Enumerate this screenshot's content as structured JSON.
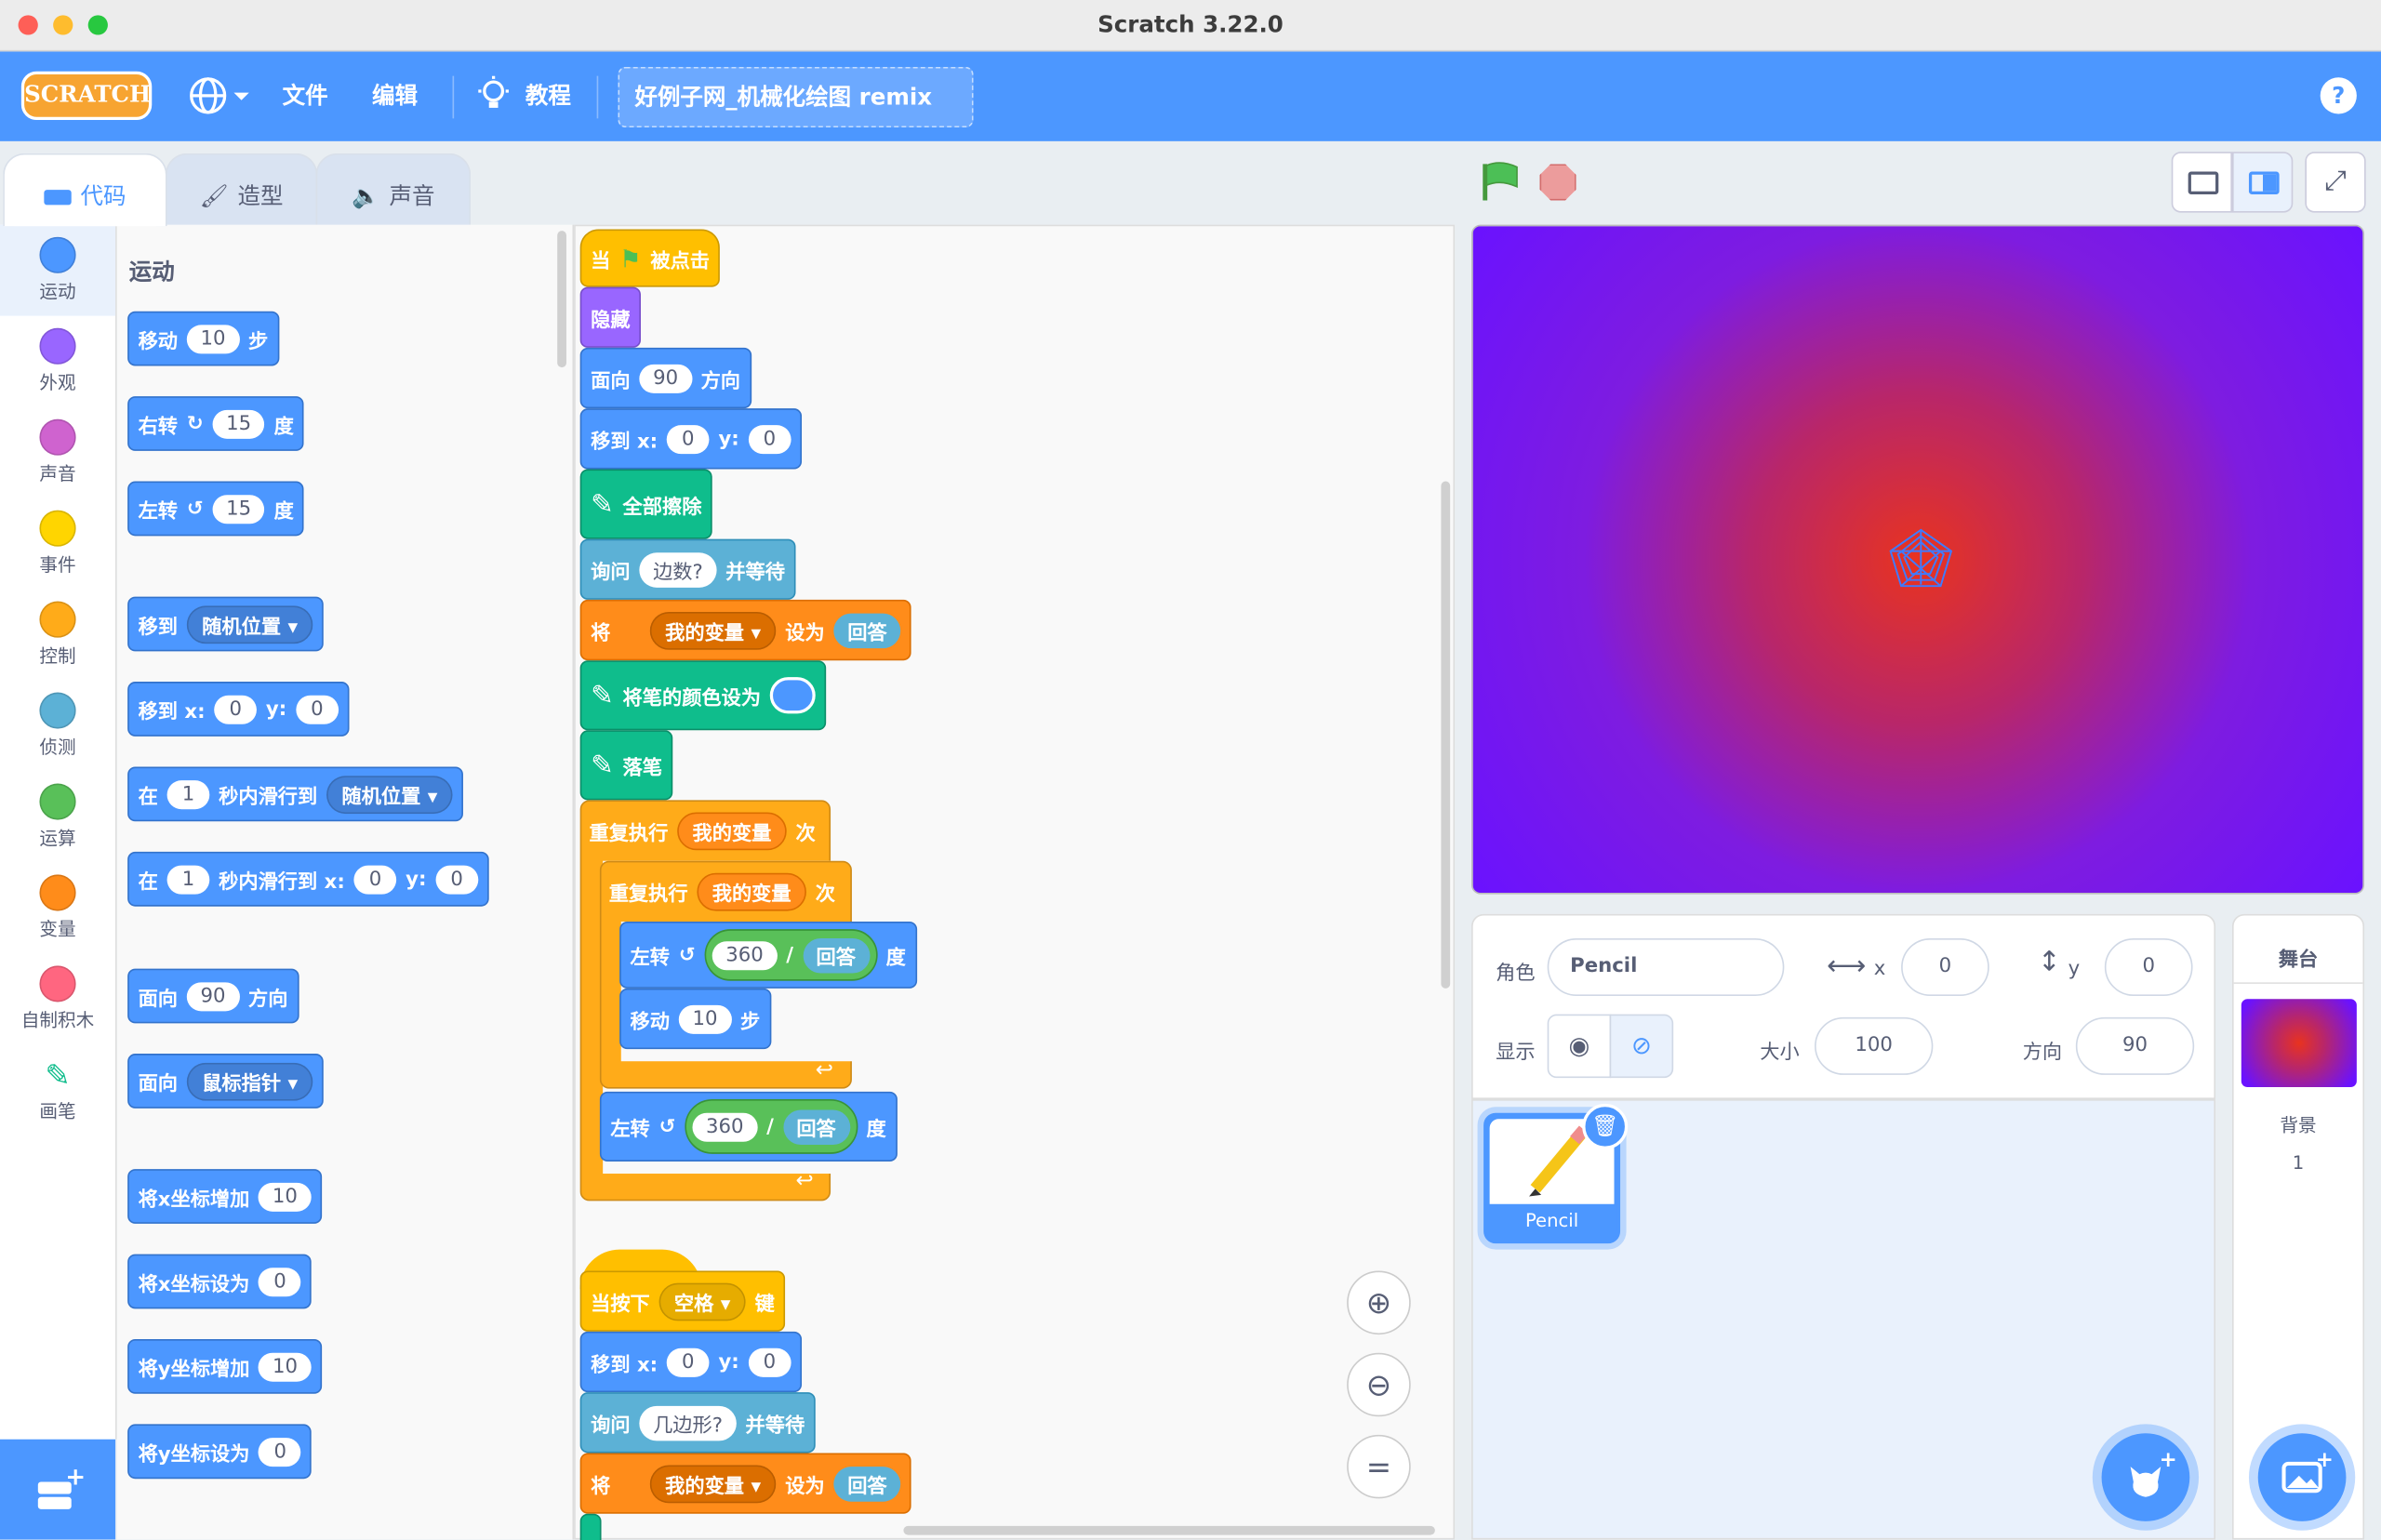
{
  "window": {
    "title": "Scratch 3.22.0"
  },
  "menubar": {
    "logo": "SCRATCH",
    "file": "文件",
    "edit": "编辑",
    "tutorials": "教程",
    "project_title": "好例子网_机械化绘图 remix",
    "help": "?"
  },
  "tabs": {
    "code": "代码",
    "costumes": "造型",
    "sounds": "声音"
  },
  "categories": [
    {
      "label": "运动",
      "color": "#4c97ff"
    },
    {
      "label": "外观",
      "color": "#9966ff"
    },
    {
      "label": "声音",
      "color": "#cf63cf"
    },
    {
      "label": "事件",
      "color": "#ffd500"
    },
    {
      "label": "控制",
      "color": "#ffab19"
    },
    {
      "label": "侦测",
      "color": "#5cb1d6"
    },
    {
      "label": "运算",
      "color": "#59c059"
    },
    {
      "label": "变量",
      "color": "#ff8c1a"
    },
    {
      "label": "自制积木",
      "color": "#ff6680"
    },
    {
      "label": "画笔",
      "color": "#0fbd8c"
    }
  ],
  "palette": {
    "heading": "运动",
    "move": {
      "a": "移动",
      "v": "10",
      "b": "步"
    },
    "turn_right": {
      "a": "右转",
      "v": "15",
      "b": "度"
    },
    "turn_left": {
      "a": "左转",
      "v": "15",
      "b": "度"
    },
    "goto": {
      "a": "移到",
      "d": "随机位置"
    },
    "goto_xy": {
      "a": "移到 x:",
      "x": "0",
      "yl": "y:",
      "y": "0"
    },
    "glide": {
      "a": "在",
      "v": "1",
      "b": "秒内滑行到",
      "d": "随机位置"
    },
    "glide_xy": {
      "a": "在",
      "v": "1",
      "b": "秒内滑行到 x:",
      "x": "0",
      "yl": "y:",
      "y": "0"
    },
    "point": {
      "a": "面向",
      "v": "90",
      "b": "方向"
    },
    "point_towards": {
      "a": "面向",
      "d": "鼠标指针"
    },
    "change_x": {
      "a": "将x坐标增加",
      "v": "10"
    },
    "set_x": {
      "a": "将x坐标设为",
      "v": "0"
    },
    "change_y": {
      "a": "将y坐标增加",
      "v": "10"
    },
    "set_y": {
      "a": "将y坐标设为",
      "v": "0"
    }
  },
  "script1": {
    "hat": {
      "a": "当",
      "b": "被点击"
    },
    "hide": "隐藏",
    "point": {
      "a": "面向",
      "v": "90",
      "b": "方向"
    },
    "goto": {
      "a": "移到 x:",
      "x": "0",
      "yl": "y:",
      "y": "0"
    },
    "clear": "全部擦除",
    "ask": {
      "a": "询问",
      "v": "边数?",
      "b": "并等待"
    },
    "setvar": {
      "a": "将",
      "d": "我的变量",
      "b": "设为",
      "r": "回答"
    },
    "pencolor": "将笔的颜色设为",
    "pendown": "落笔",
    "repeat1": {
      "a": "重复执行",
      "v": "我的变量",
      "b": "次"
    },
    "repeat2": {
      "a": "重复执行",
      "v": "我的变量",
      "b": "次"
    },
    "turn1": {
      "a": "左转",
      "n": "360",
      "op": "/",
      "r": "回答",
      "b": "度"
    },
    "move": {
      "a": "移动",
      "v": "10",
      "b": "步"
    },
    "turn2": {
      "a": "左转",
      "n": "360",
      "op": "/",
      "r": "回答",
      "b": "度"
    }
  },
  "script2": {
    "hat": {
      "a": "当按下",
      "d": "空格",
      "b": "键"
    },
    "goto": {
      "a": "移到 x:",
      "x": "0",
      "yl": "y:",
      "y": "0"
    },
    "ask": {
      "a": "询问",
      "v": "几边形?",
      "b": "并等待"
    },
    "setvar": {
      "a": "将",
      "d": "我的变量",
      "b": "设为",
      "r": "回答"
    }
  },
  "sprite_info": {
    "sprite_label": "角色",
    "sprite_name": "Pencil",
    "x_label": "x",
    "x": "0",
    "y_label": "y",
    "y": "0",
    "show_label": "显示",
    "size_label": "大小",
    "size": "100",
    "direction_label": "方向",
    "direction": "90"
  },
  "sprites": [
    {
      "name": "Pencil"
    }
  ],
  "stage_panel": {
    "title": "舞台",
    "backdrops_label": "背景",
    "backdrops_count": "1"
  }
}
